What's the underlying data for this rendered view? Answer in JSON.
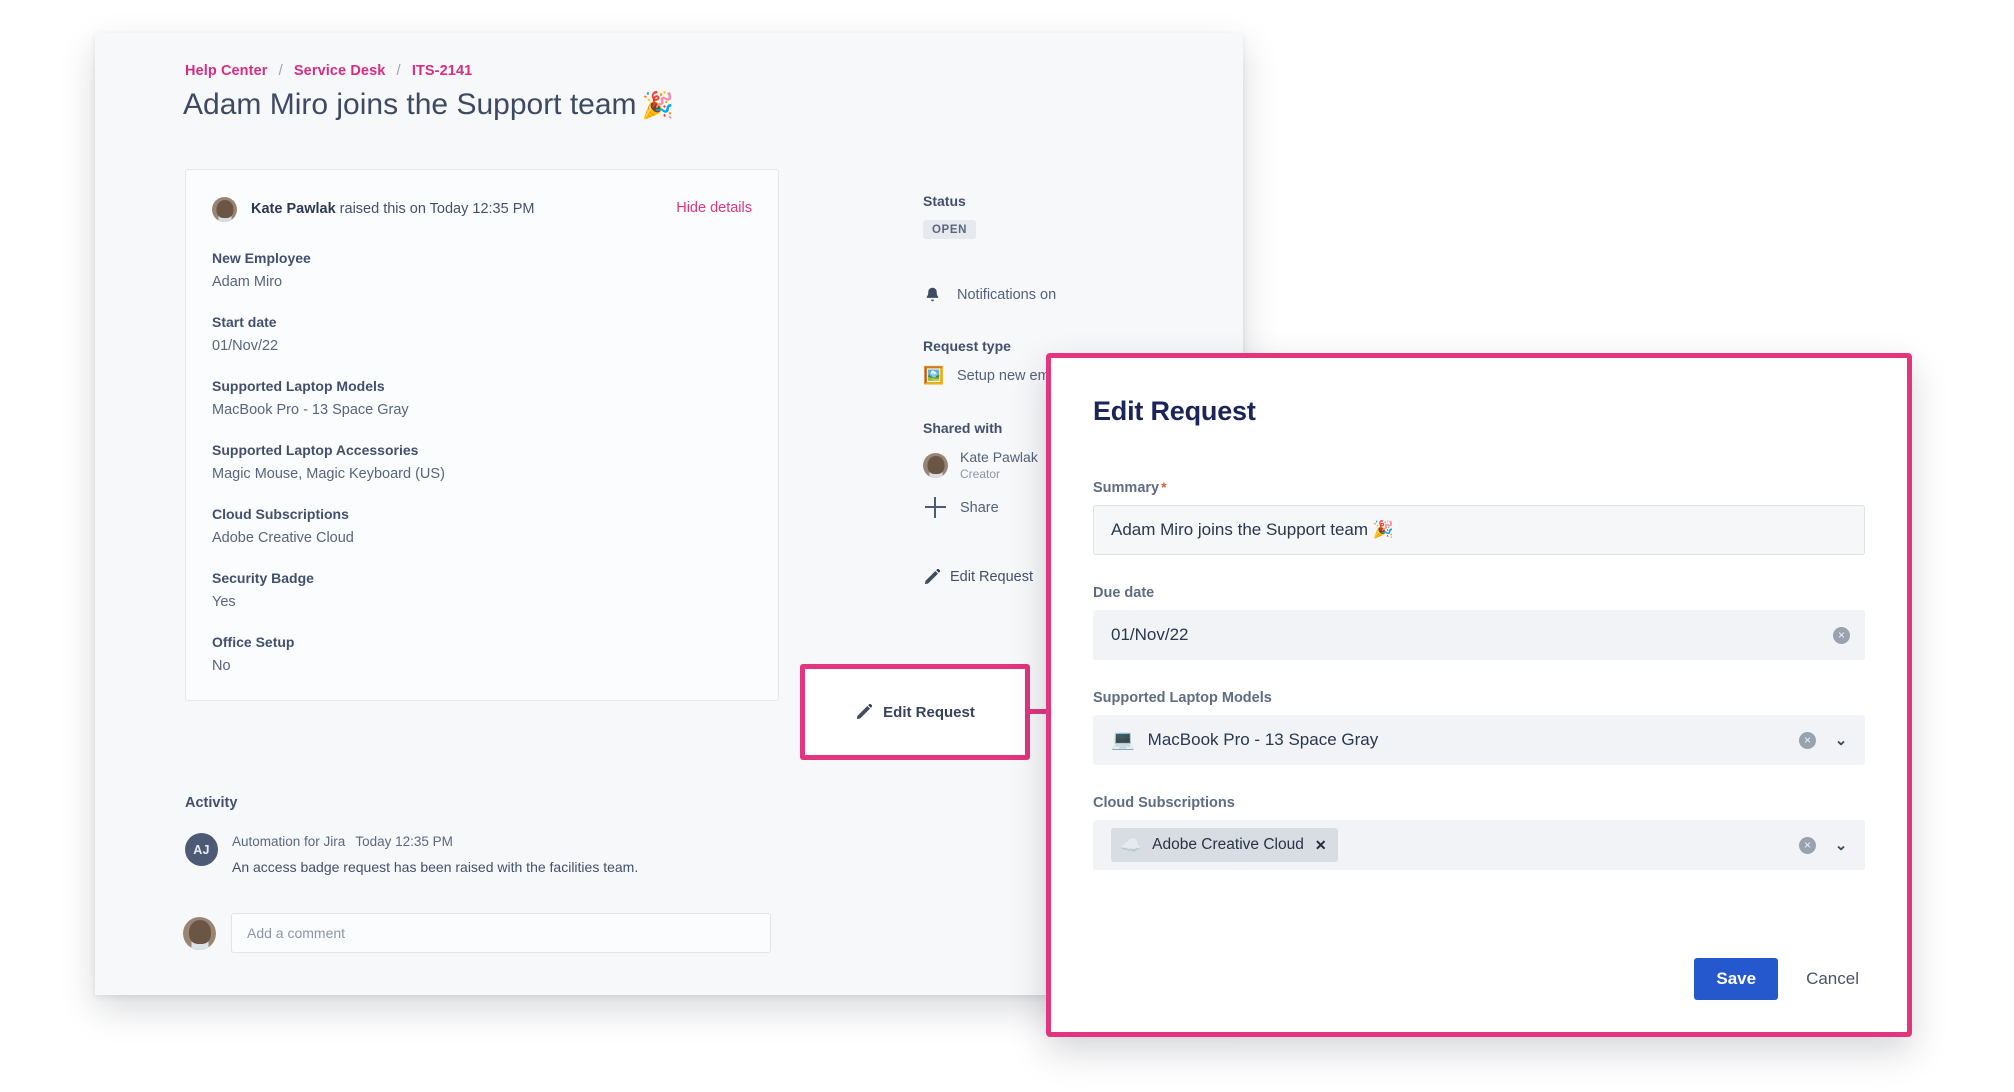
{
  "portal": {
    "breadcrumb": {
      "items": [
        "Help Center",
        "Service Desk",
        "ITS-2141"
      ],
      "separator": "/"
    },
    "title": "Adam Miro joins the Support team",
    "title_emoji": "🎉",
    "details_card": {
      "reporter_name": "Kate Pawlak",
      "reporter_suffix": "raised this on Today 12:35 PM",
      "hide_details_label": "Hide details",
      "fields": [
        {
          "label": "New Employee",
          "value": "Adam Miro"
        },
        {
          "label": "Start date",
          "value": "01/Nov/22"
        },
        {
          "label": "Supported Laptop Models",
          "value": "MacBook Pro - 13 Space Gray"
        },
        {
          "label": "Supported Laptop Accessories",
          "value": "Magic Mouse, Magic Keyboard (US)"
        },
        {
          "label": "Cloud Subscriptions",
          "value": "Adobe Creative Cloud"
        },
        {
          "label": "Security Badge",
          "value": "Yes"
        },
        {
          "label": "Office Setup",
          "value": "No"
        }
      ]
    },
    "activity": {
      "heading": "Activity",
      "entry": {
        "avatar_initials": "AJ",
        "author": "Automation for Jira",
        "timestamp": "Today 12:35 PM",
        "text": "An access badge request has been raised with the facilities team."
      },
      "comment_placeholder": "Add a comment"
    },
    "sidebar": {
      "status_label": "Status",
      "status_value": "OPEN",
      "notifications_label": "Notifications on",
      "notifications_icon": "bell-icon",
      "request_type_label": "Request type",
      "request_type_value": "Setup new employee",
      "request_type_icon": "🖼️",
      "shared_with_label": "Shared with",
      "shared_person_name": "Kate Pawlak",
      "shared_person_role": "Creator",
      "share_label": "Share",
      "edit_request_label": "Edit Request"
    }
  },
  "callout": {
    "edit_request_label": "Edit Request",
    "highlight_color": "#E2357E"
  },
  "modal": {
    "title": "Edit Request",
    "accent_color": "#E2357E",
    "fields": {
      "summary": {
        "label": "Summary",
        "required_marker": "*",
        "value": "Adam Miro joins the Support team 🎉"
      },
      "due_date": {
        "label": "Due date",
        "value": "01/Nov/22",
        "clear_icon": "×"
      },
      "laptop_models": {
        "label": "Supported Laptop Models",
        "value": "MacBook Pro - 13 Space Gray",
        "emoji": "💻",
        "clear_icon": "×",
        "chevron_icon": "⌄"
      },
      "cloud_subscriptions": {
        "label": "Cloud Subscriptions",
        "tag_label": "Adobe Creative Cloud",
        "tag_emoji": "☁️",
        "tag_remove": "✕",
        "clear_icon": "×",
        "chevron_icon": "⌄"
      }
    },
    "save_label": "Save",
    "cancel_label": "Cancel",
    "save_color": "#2558CC"
  }
}
